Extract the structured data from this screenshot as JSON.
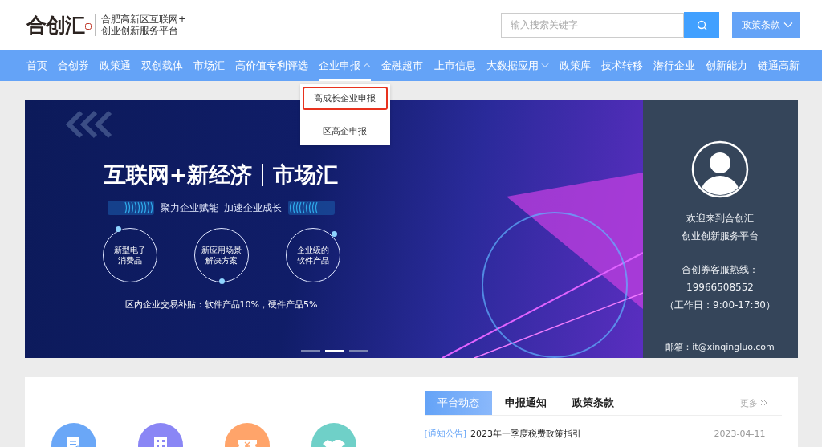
{
  "header": {
    "logo": "合创汇",
    "tagline_lines": [
      "合肥高新区互联网+",
      "创业创新服务平台"
    ],
    "search": {
      "placeholder": "输入搜索关键字"
    },
    "category_select": {
      "value": "政策条款"
    }
  },
  "nav": {
    "items": [
      {
        "label": "首页",
        "has_menu": false,
        "expanded": false
      },
      {
        "label": "合创券",
        "has_menu": false,
        "expanded": false
      },
      {
        "label": "政策通",
        "has_menu": false,
        "expanded": false
      },
      {
        "label": "双创载体",
        "has_menu": false,
        "expanded": false
      },
      {
        "label": "市场汇",
        "has_menu": false,
        "expanded": false
      },
      {
        "label": "高价值专利评选",
        "has_menu": false,
        "expanded": false
      },
      {
        "label": "企业申报",
        "has_menu": true,
        "expanded": true,
        "menu": [
          {
            "label": "高成长企业申报",
            "selected": true
          },
          {
            "label": "区高企申报",
            "selected": false
          }
        ]
      },
      {
        "label": "金融超市",
        "has_menu": false,
        "expanded": false
      },
      {
        "label": "上市信息",
        "has_menu": false,
        "expanded": false
      },
      {
        "label": "大数据应用",
        "has_menu": true,
        "expanded": false
      },
      {
        "label": "政策库",
        "has_menu": false,
        "expanded": false
      },
      {
        "label": "技术转移",
        "has_menu": false,
        "expanded": false
      },
      {
        "label": "潜行企业",
        "has_menu": false,
        "expanded": false
      },
      {
        "label": "创新能力",
        "has_menu": false,
        "expanded": false
      },
      {
        "label": "链通高新",
        "has_menu": false,
        "expanded": false
      }
    ]
  },
  "banner": {
    "title_left": "互联网+新经济",
    "title_right": "市场汇",
    "slogan": "聚力企业赋能  加速企业成长",
    "circles": [
      {
        "lines": [
          "新型电子",
          "消费品"
        ]
      },
      {
        "lines": [
          "新应用场景",
          "解决方案"
        ]
      },
      {
        "lines": [
          "企业级的",
          "软件产品"
        ]
      }
    ],
    "subsidy": "区内企业交易补贴：软件产品10%，硬件产品5%",
    "slides": [
      {
        "selected": false
      },
      {
        "selected": true
      },
      {
        "selected": false
      }
    ]
  },
  "welcome_panel": {
    "lines": [
      "欢迎来到合创汇",
      "创业创新服务平台"
    ],
    "hotline_label": "合创券客服热线：",
    "phone": "19966508552",
    "hours": "（工作日：9:00-17:30）",
    "email": "邮箱：it@xinqingluo.com"
  },
  "services": [
    {
      "kind": "document",
      "color": "#6aa7f7"
    },
    {
      "kind": "building",
      "color": "#8a86f5"
    },
    {
      "kind": "ticket",
      "color": "#ffa46a"
    },
    {
      "kind": "handshake",
      "color": "#6fd0c8"
    }
  ],
  "news": {
    "tabs": [
      {
        "label": "平台动态",
        "selected": true
      },
      {
        "label": "申报通知",
        "selected": false
      },
      {
        "label": "政策条款",
        "selected": false
      }
    ],
    "more": "更多",
    "items": [
      {
        "tag": "[通知公告]",
        "title": "2023年一季度税费政策指引",
        "date": "2023-04-11"
      }
    ]
  }
}
